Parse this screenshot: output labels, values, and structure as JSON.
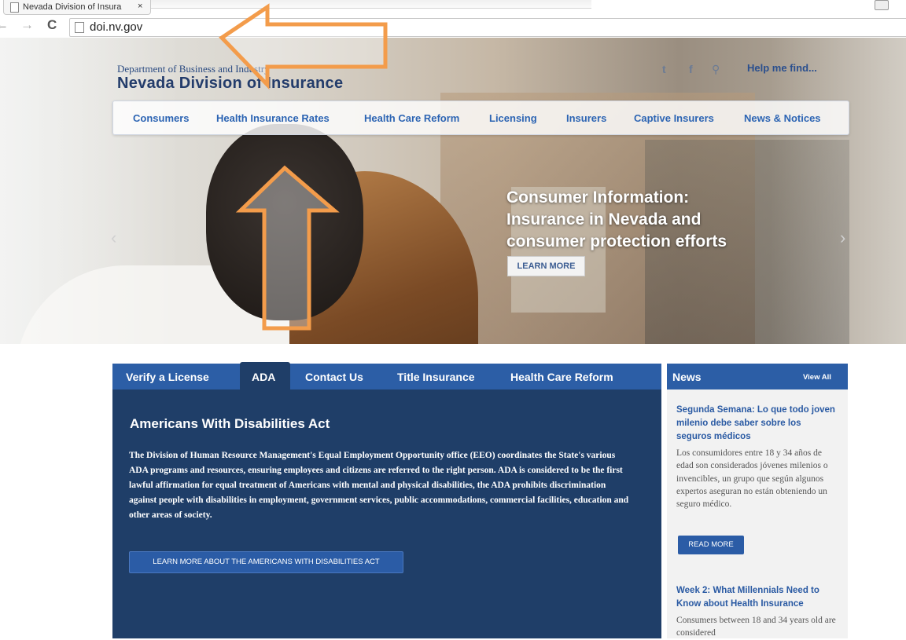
{
  "browser": {
    "tab_title": "Nevada Division of Insura",
    "tab_close": "×",
    "url": "doi.nv.gov",
    "back": "←",
    "forward": "→",
    "reload": "C"
  },
  "header": {
    "department": "Department of Business and Industry",
    "site_name": "Nevada Division of Insurance",
    "social_twitter": "t",
    "social_facebook": "f",
    "search_glyph": "⚲",
    "help_link": "Help me find..."
  },
  "nav": {
    "items": [
      "Consumers",
      "Health Insurance Rates",
      "Health Care Reform",
      "Licensing",
      "Insurers",
      "Captive Insurers",
      "News & Notices"
    ]
  },
  "hero": {
    "title_line1": "Consumer Information:",
    "title_line2": "Insurance in Nevada and",
    "title_line3": "consumer protection efforts",
    "cta": "LEARN MORE",
    "prev": "‹",
    "next": "›"
  },
  "content_tabs": {
    "items": [
      "Verify a License",
      "ADA",
      "Contact Us",
      "Title Insurance",
      "Health Care Reform"
    ],
    "active": "ADA",
    "panel_title": "Americans With Disabilities Act",
    "panel_body": "The Division of Human Resource Management's Equal Employment Opportunity office (EEO) coordinates the State's various ADA programs and resources, ensuring employees and citizens are referred to the right person.  ADA is considered to be the first lawful affirmation for equal treatment of Americans with mental and physical disabilities, the ADA prohibits discrimination against people with disabilities in employment, government services, public accommodations, commercial facilities, education and other areas of society.",
    "panel_button": "LEARN MORE ABOUT THE AMERICANS WITH DISABILITIES ACT"
  },
  "news": {
    "title": "News",
    "view_all": "View All",
    "items": [
      {
        "headline": "Segunda Semana: Lo que todo joven milenio debe saber sobre los seguros médicos",
        "summary": "Los consumidores entre 18 y 34 años de edad son considerados jóvenes milenios o invencibles, un grupo que según algunos expertos aseguran no están obteniendo un seguro médico.",
        "button": "READ MORE"
      },
      {
        "headline": "Week 2: What Millennials Need to Know about Health Insurance",
        "summary": "Consumers between 18 and 34 years old are considered"
      }
    ]
  },
  "colors": {
    "overlay_arrow": "#f39c4b",
    "nav_blue": "#2c64b3",
    "panel_navy": "#1f3e68",
    "tab_blue": "#2c5ea6"
  }
}
